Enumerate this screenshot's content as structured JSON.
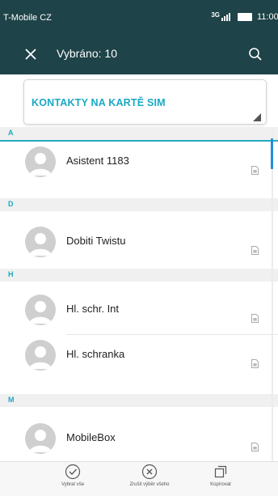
{
  "status_bar": {
    "carrier": "T-Mobile CZ",
    "network": "3G",
    "time": "11:00"
  },
  "toolbar": {
    "title": "Vybráno: 10",
    "close_icon": "close-icon",
    "search_icon": "search-icon"
  },
  "account_selector": {
    "label": "KONTAKTY NA KARTĚ SIM"
  },
  "contacts": {
    "sections": [
      {
        "letter": "A",
        "items": [
          {
            "name": "Asistent 1183"
          }
        ]
      },
      {
        "letter": "D",
        "items": [
          {
            "name": "Dobiti Twistu"
          }
        ]
      },
      {
        "letter": "H",
        "items": [
          {
            "name": "Hl. schr. Int"
          },
          {
            "name": "Hl. schranka"
          }
        ]
      },
      {
        "letter": "M",
        "items": [
          {
            "name": "MobileBox"
          }
        ]
      }
    ]
  },
  "bottom_bar": {
    "select_all": "Vybrat vše",
    "deselect_all": "Zrušit výběr všeho",
    "copy": "Kopírovat"
  },
  "colors": {
    "toolbar": "#1e4348",
    "accent": "#1aa9c4",
    "scroll_thumb": "#1f8fd6",
    "brand_mark": "#e2007a"
  }
}
